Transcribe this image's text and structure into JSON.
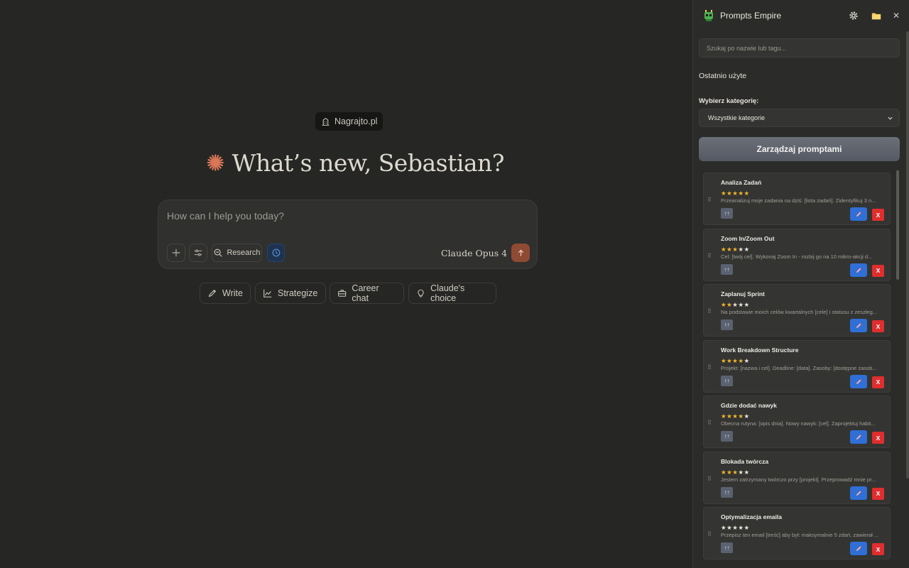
{
  "main": {
    "org_badge": "Nagrajto.pl",
    "greeting": "What’s new, Sebastian?",
    "composer": {
      "placeholder": "How can I help you today?",
      "research_label": "Research",
      "model_label": "Claude Opus 4"
    },
    "suggestions": [
      {
        "label": "Write",
        "icon": "pencil-icon"
      },
      {
        "label": "Strategize",
        "icon": "chart-line-icon"
      },
      {
        "label": "Career chat",
        "icon": "briefcase-icon"
      },
      {
        "label": "Claude's choice",
        "icon": "lightbulb-icon"
      }
    ],
    "accent_color": "#d97757"
  },
  "panel": {
    "title": "Prompts Empire",
    "search_placeholder": "Szukaj po nazwie lub tagu...",
    "recent_label": "Ostatnio użyte",
    "category_label": "Wybierz kategorię:",
    "category_selected": "Wszystkie kategorie",
    "manage_label": "Zarządzaj promptami",
    "up_label": "↑↑",
    "delete_label": "X",
    "prompts": [
      {
        "title": "Analiza Zadań",
        "rating": 5,
        "preview": "Przeanalizuj moje zadania na dziś: [lista zadań]. Zidentyfikuj 3 n..."
      },
      {
        "title": "Zoom In/Zoom Out",
        "rating": 3,
        "preview": "Cel: [twój cel]. Wykonaj Zoom In - rozbij go na 10 mikro-akcji d..."
      },
      {
        "title": "Zaplanuj Sprint",
        "rating": 2,
        "preview": "Na podstawie moich celów kwartalnych [cele] i statusu z zeszłeg..."
      },
      {
        "title": "Work Breakdown Structure",
        "rating": 4,
        "preview": "Projekt: [nazwa i cel]. Deadline: [data]. Zasoby: [dostępne zasob..."
      },
      {
        "title": "Gdzie dodać nawyk",
        "rating": 4,
        "preview": "Obecna rutyna: [opis dnia]. Nowy nawyk: [cel]. Zaprojektuj habit..."
      },
      {
        "title": "Blokada twórcza",
        "rating": 3,
        "preview": "Jestem zatrzymany twórczo przy [projekt]. Przeprowadź mnie pr..."
      },
      {
        "title": "Optymalizacja emaila",
        "rating": 0,
        "preview": "Przepisz ten email [treść] aby był: maksymalnie 5 zdań, zawierał ..."
      }
    ]
  }
}
